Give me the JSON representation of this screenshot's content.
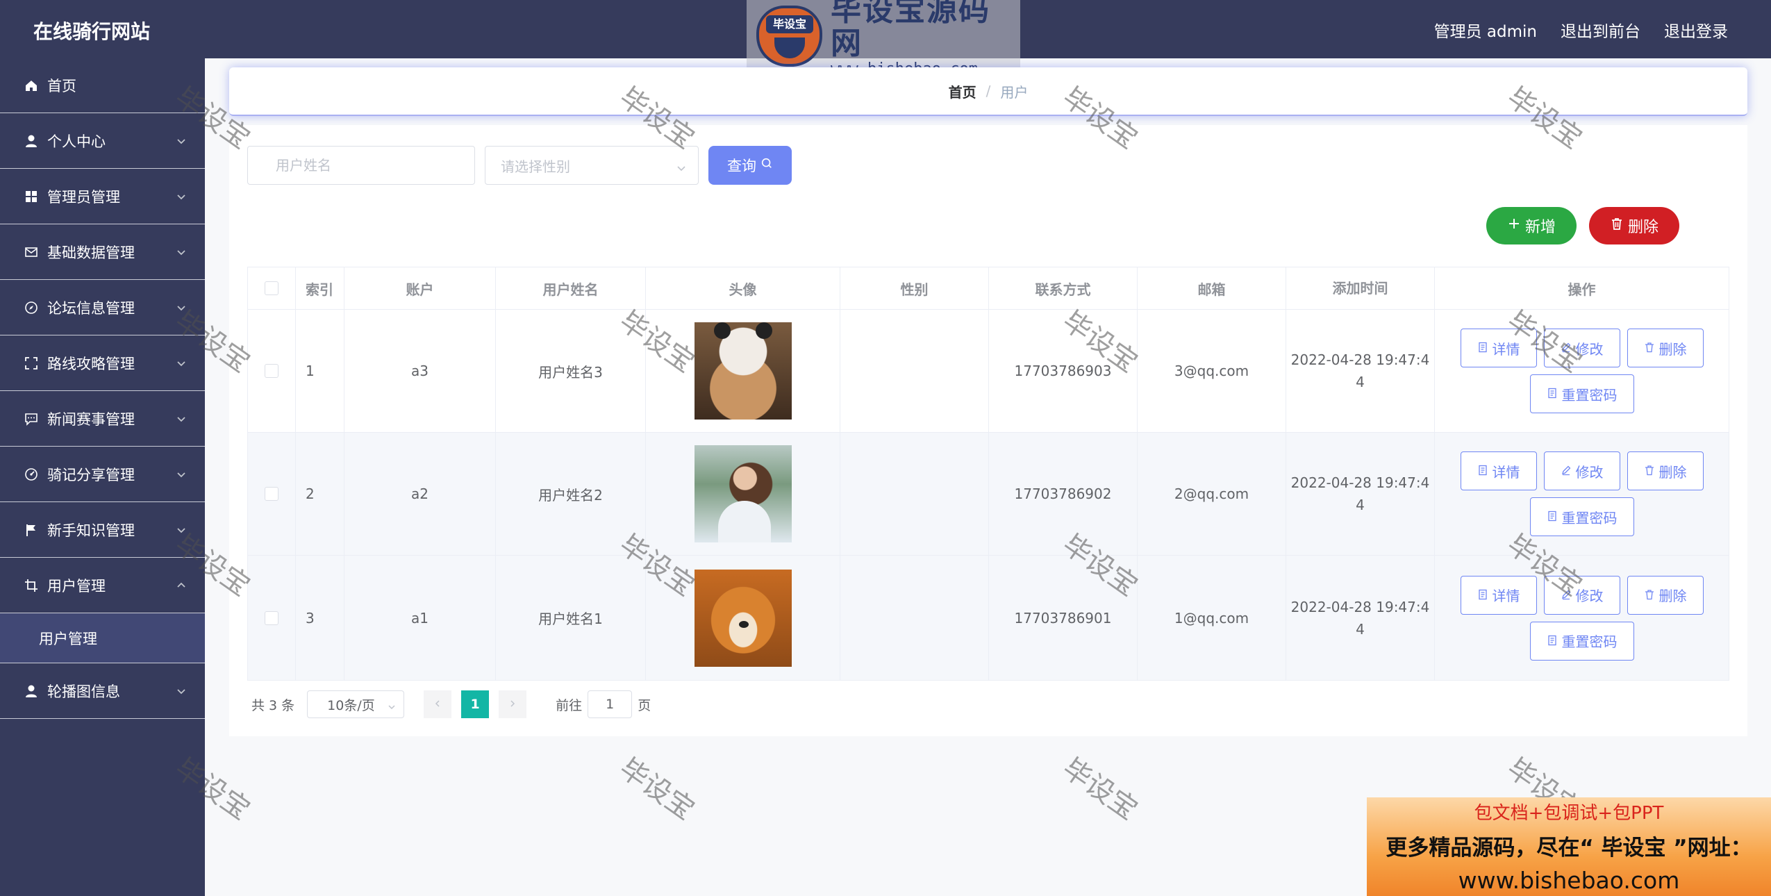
{
  "header": {
    "app_title": "在线骑行网站",
    "admin_label": "管理员 admin",
    "back_to_front": "退出到前台",
    "logout": "退出登录"
  },
  "logo": {
    "badge_text": "毕设宝",
    "main_text": "毕设宝源码网",
    "url_text": "www.bishebao.com"
  },
  "sidebar": {
    "items": [
      {
        "label": "首页",
        "icon": "home-icon"
      },
      {
        "label": "个人中心",
        "icon": "user-icon"
      },
      {
        "label": "管理员管理",
        "icon": "grid-icon"
      },
      {
        "label": "基础数据管理",
        "icon": "mail-icon"
      },
      {
        "label": "论坛信息管理",
        "icon": "compass-icon"
      },
      {
        "label": "路线攻略管理",
        "icon": "frame-icon"
      },
      {
        "label": "新闻赛事管理",
        "icon": "chat-icon"
      },
      {
        "label": "骑记分享管理",
        "icon": "gauge-icon"
      },
      {
        "label": "新手知识管理",
        "icon": "flag-icon"
      },
      {
        "label": "用户管理",
        "icon": "crop-icon"
      },
      {
        "label": "轮播图信息",
        "icon": "user-icon"
      }
    ],
    "submenu_label": "用户管理"
  },
  "breadcrumb": {
    "home": "首页",
    "separator": "/",
    "current": "用户"
  },
  "search": {
    "name_placeholder": "用户姓名",
    "gender_placeholder": "请选择性别",
    "query_label": "查询"
  },
  "actions": {
    "add_label": "新增",
    "delete_label": "删除"
  },
  "table": {
    "columns": [
      "索引",
      "账户",
      "用户姓名",
      "头像",
      "性别",
      "联系方式",
      "邮箱",
      "添加时间",
      "操作"
    ],
    "rows": [
      {
        "index": "1",
        "account": "a3",
        "name": "用户姓名3",
        "gender": "",
        "phone": "17703786903",
        "email": "3@qq.com",
        "time_line1": "2022-04-28 19:47:4",
        "time_line2": "4"
      },
      {
        "index": "2",
        "account": "a2",
        "name": "用户姓名2",
        "gender": "",
        "phone": "17703786902",
        "email": "2@qq.com",
        "time_line1": "2022-04-28 19:47:4",
        "time_line2": "4"
      },
      {
        "index": "3",
        "account": "a1",
        "name": "用户姓名1",
        "gender": "",
        "phone": "17703786901",
        "email": "1@qq.com",
        "time_line1": "2022-04-28 19:47:4",
        "time_line2": "4"
      }
    ],
    "op_detail": "详情",
    "op_edit": "修改",
    "op_delete": "删除",
    "op_reset": "重置密码"
  },
  "pagination": {
    "total": "共 3 条",
    "page_size": "10条/页",
    "current_page": "1",
    "goto_label": "前往",
    "goto_value": "1",
    "page_suffix": "页"
  },
  "watermark": "毕设宝",
  "ad": {
    "line1": "包文档+包调试+包PPT",
    "line2": "更多精品源码，尽在“ 毕设宝 ”网址：",
    "line3": "www.bishebao.com"
  },
  "colors": {
    "header_bg": "#363b5c",
    "primary": "#6f86f3",
    "success": "#2ba843",
    "danger": "#d11f24",
    "pager_active": "#13b6a5"
  }
}
